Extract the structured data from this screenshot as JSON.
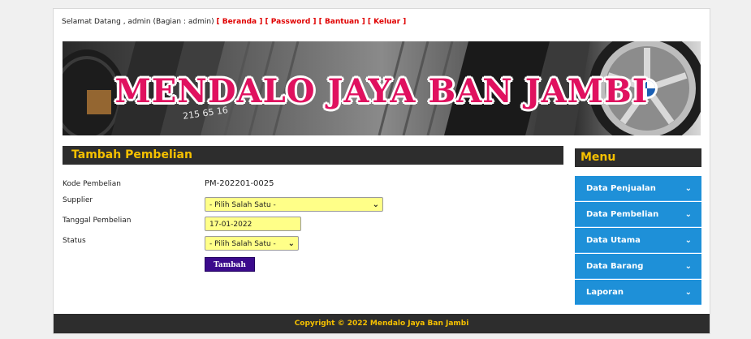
{
  "header": {
    "welcome_text": "Selamat Datang , admin (Bagian : admin)",
    "links": [
      "Beranda",
      "Password",
      "Bantuan",
      "Keluar"
    ]
  },
  "banner": {
    "title": "MENDALO JAYA BAN JAMBI",
    "tire_text": "215 65 16"
  },
  "form": {
    "title": "Tambah Pembelian",
    "kode_label": "Kode Pembelian",
    "kode_value": "PM-202201-0025",
    "supplier_label": "Supplier",
    "supplier_value": "- Pilih Salah Satu -",
    "tanggal_label": "Tanggal Pembelian",
    "tanggal_value": "17-01-2022",
    "status_label": "Status",
    "status_value": "- Pilih Salah Satu -",
    "submit_label": "Tambah"
  },
  "menu": {
    "title": "Menu",
    "items": [
      "Data Penjualan",
      "Data Pembelian",
      "Data Utama",
      "Data Barang",
      "Laporan"
    ],
    "chevron": "chevron-down-icon"
  },
  "footer": {
    "text": "Copyright © 2022 Mendalo Jaya Ban Jambi"
  },
  "colors": {
    "accent": "#f5c000",
    "brand": "#e0115f",
    "menu_bg": "#1e90d8",
    "panel_bg": "#2d2d2d",
    "field_bg": "#ffff88",
    "button_bg": "#3b0a8c"
  }
}
